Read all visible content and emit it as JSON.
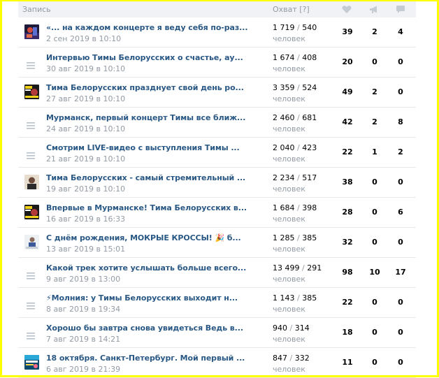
{
  "header": {
    "post_label": "Запись",
    "reach_label": "Охват [?]",
    "likes_icon": "heart-icon",
    "shares_icon": "megaphone-icon",
    "comments_icon": "comment-icon"
  },
  "reach_unit": "человек",
  "rows": [
    {
      "thumb": "photo",
      "title": "«... на каждом концерте я веду себя по-раз...",
      "date": "2 сен 2019 в 10:10",
      "reach_total": "1 719",
      "reach_sub": "540",
      "likes": "39",
      "shares": "2",
      "comments": "4"
    },
    {
      "thumb": "text",
      "title": "Интервью Тимы Белорусских о счастье, ау...",
      "date": "30 авг 2019 в 10:10",
      "reach_total": "1 674",
      "reach_sub": "408",
      "likes": "20",
      "shares": "0",
      "comments": "0"
    },
    {
      "thumb": "poster",
      "title": "Тима Белорусских празднует свой день ро...",
      "date": "27 авг 2019 в 10:10",
      "reach_total": "3 359",
      "reach_sub": "524",
      "likes": "49",
      "shares": "2",
      "comments": "0"
    },
    {
      "thumb": "text",
      "title": "Мурманск, первый концерт Тимы все ближ...",
      "date": "24 авг 2019 в 10:10",
      "reach_total": "2 460",
      "reach_sub": "681",
      "likes": "42",
      "shares": "2",
      "comments": "8"
    },
    {
      "thumb": "text",
      "title": "Смотрим LIVE-видео с выступления Тимы ...",
      "date": "21 авг 2019 в 10:10",
      "reach_total": "2 040",
      "reach_sub": "423",
      "likes": "22",
      "shares": "1",
      "comments": "2"
    },
    {
      "thumb": "portrait",
      "title": "Тима Белорусских - самый стремительный ...",
      "date": "19 авг 2019 в 10:10",
      "reach_total": "2 234",
      "reach_sub": "517",
      "likes": "38",
      "shares": "0",
      "comments": "0"
    },
    {
      "thumb": "poster",
      "title": "Впервые в Мурманске! Тима Белорусских в...",
      "date": "16 авг 2019 в 16:33",
      "reach_total": "1 684",
      "reach_sub": "398",
      "likes": "28",
      "shares": "0",
      "comments": "6"
    },
    {
      "thumb": "person",
      "title": "С днём рождения, МОКРЫЕ КРОССЫ! 🎉 б...",
      "date": "13 авг 2019 в 15:01",
      "reach_total": "1 285",
      "reach_sub": "385",
      "likes": "32",
      "shares": "0",
      "comments": "0"
    },
    {
      "thumb": "text",
      "title": "Какой трек хотите услышать больше всего...",
      "date": "9 авг 2019 в 13:00",
      "reach_total": "13 499",
      "reach_sub": "291",
      "likes": "98",
      "shares": "10",
      "comments": "17"
    },
    {
      "thumb": "text",
      "title": "⚡Молния: у Тимы Белорусских выходит н...",
      "date": "8 авг 2019 в 19:34",
      "reach_total": "1 143",
      "reach_sub": "385",
      "likes": "22",
      "shares": "0",
      "comments": "0"
    },
    {
      "thumb": "text",
      "title": "Хорошо бы завтра снова увидеться Ведь в...",
      "date": "7 авг 2019 в 14:21",
      "reach_total": "940",
      "reach_sub": "314",
      "likes": "18",
      "shares": "0",
      "comments": "0"
    },
    {
      "thumb": "concert",
      "title": "18 октября. Санкт-Петербург. Мой первый ...",
      "date": "6 авг 2019 в 21:39",
      "reach_total": "847",
      "reach_sub": "332",
      "likes": "11",
      "shares": "0",
      "comments": "0"
    }
  ]
}
